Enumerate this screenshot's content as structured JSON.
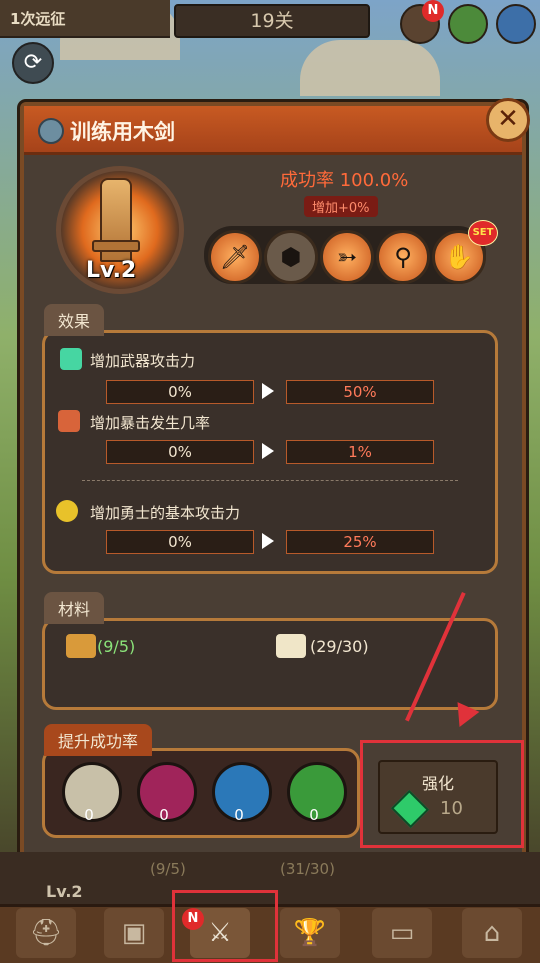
{
  "hud": {
    "expedition": "1次远征",
    "stage": "19关",
    "notification_badge": "N"
  },
  "panel": {
    "title": "训练用木剑",
    "level": "Lv.2",
    "success_rate": "成功率 100.0%",
    "rate_bonus": "增加+0%",
    "set_badge": "SET",
    "slots": [
      "dagger",
      "shield",
      "bow",
      "staff",
      "claw"
    ]
  },
  "effects": {
    "tab": "效果",
    "rows": [
      {
        "label": "增加武器攻击力",
        "from": "0%",
        "to": "50%"
      },
      {
        "label": "增加暴击发生几率",
        "from": "0%",
        "to": "1%"
      },
      {
        "label": "增加勇士的基本攻击力",
        "from": "0%",
        "to": "25%"
      }
    ]
  },
  "materials": {
    "tab": "材料",
    "items": [
      {
        "count": "(9/5)",
        "icon": "ticket-icon"
      },
      {
        "count": "(29/30)",
        "icon": "bone-icon"
      }
    ]
  },
  "boost": {
    "tab": "提升成功率",
    "gems": [
      {
        "color": "#c8c0a8",
        "count": "0"
      },
      {
        "color": "#a0245a",
        "count": "0"
      },
      {
        "color": "#2b78b8",
        "count": "0"
      },
      {
        "color": "#3a9a3a",
        "count": "0"
      }
    ]
  },
  "upgrade": {
    "label": "强化",
    "cost": "10"
  },
  "behind": {
    "level": "Lv.2",
    "mat1": "(9/5)",
    "mat2": "(31/30)"
  },
  "nav": {
    "badge": "N",
    "items": [
      "knight-icon",
      "armor-icon",
      "swords-icon",
      "trophy-icon",
      "belt-icon",
      "shop-icon"
    ]
  }
}
